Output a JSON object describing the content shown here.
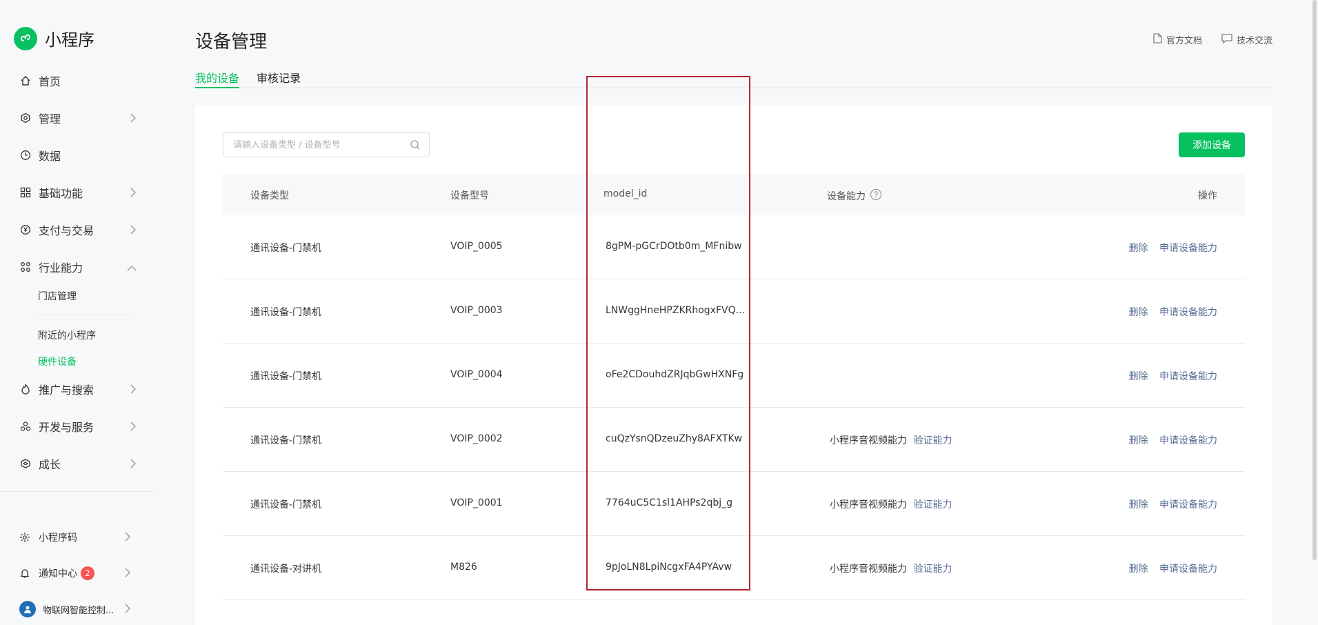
{
  "app": {
    "name": "小程序"
  },
  "sidebar": {
    "items": [
      {
        "label": "首页",
        "icon": "home-icon",
        "has_arrow": false
      },
      {
        "label": "管理",
        "icon": "settings-icon",
        "has_arrow": true
      },
      {
        "label": "数据",
        "icon": "clock-icon",
        "has_arrow": false
      },
      {
        "label": "基础功能",
        "icon": "grid-icon",
        "has_arrow": true
      },
      {
        "label": "支付与交易",
        "icon": "yen-icon",
        "has_arrow": true
      },
      {
        "label": "行业能力",
        "icon": "industry-icon",
        "has_arrow": true,
        "expanded": true
      },
      {
        "label": "推广与搜索",
        "icon": "flame-icon",
        "has_arrow": true
      },
      {
        "label": "开发与服务",
        "icon": "dev-icon",
        "has_arrow": true
      },
      {
        "label": "成长",
        "icon": "growth-icon",
        "has_arrow": true
      }
    ],
    "sub_items": [
      {
        "label": "门店管理"
      },
      {
        "label": "附近的小程序"
      },
      {
        "label": "硬件设备",
        "active": true
      }
    ],
    "bottom": [
      {
        "label": "小程序码",
        "icon": "qrcode-icon"
      },
      {
        "label": "通知中心",
        "icon": "bell-icon",
        "badge": "2"
      },
      {
        "label": "物联网智能控制...",
        "icon": "avatar"
      }
    ]
  },
  "header": {
    "title": "设备管理",
    "links": [
      {
        "label": "官方文档",
        "icon": "document-icon"
      },
      {
        "label": "技术交流",
        "icon": "chat-icon"
      }
    ]
  },
  "tabs": [
    {
      "label": "我的设备",
      "active": true
    },
    {
      "label": "审核记录",
      "active": false
    }
  ],
  "search": {
    "placeholder": "请输入设备类型 / 设备型号",
    "value": ""
  },
  "add_button": "添加设备",
  "table": {
    "columns": [
      "设备类型",
      "设备型号",
      "model_id",
      "设备能力",
      "操作"
    ],
    "rows": [
      {
        "type": "通讯设备-门禁机",
        "model": "VOIP_0005",
        "model_id": "8gPM-pGCrDOtb0m_MFnibw",
        "capability": "",
        "verify": ""
      },
      {
        "type": "通讯设备-门禁机",
        "model": "VOIP_0003",
        "model_id": "LNWggHneHPZKRhogxFVQ...",
        "capability": "",
        "verify": ""
      },
      {
        "type": "通讯设备-门禁机",
        "model": "VOIP_0004",
        "model_id": "oFe2CDouhdZRJqbGwHXNFg",
        "capability": "",
        "verify": ""
      },
      {
        "type": "通讯设备-门禁机",
        "model": "VOIP_0002",
        "model_id": "cuQzYsnQDzeuZhy8AFXTKw",
        "capability": "小程序音视频能力",
        "verify": "验证能力"
      },
      {
        "type": "通讯设备-门禁机",
        "model": "VOIP_0001",
        "model_id": "7764uC5C1sl1AHPs2qbj_g",
        "capability": "小程序音视频能力",
        "verify": "验证能力"
      },
      {
        "type": "通讯设备-对讲机",
        "model": "M826",
        "model_id": "9pJoLN8LpiNcgxFA4PYAvw",
        "capability": "小程序音视频能力",
        "verify": "验证能力"
      }
    ],
    "actions": {
      "delete": "删除",
      "apply": "申请设备能力"
    }
  },
  "colors": {
    "accent": "#07c160",
    "link": "#576b95",
    "annotation": "#b3262d",
    "badge": "#fa5151"
  }
}
